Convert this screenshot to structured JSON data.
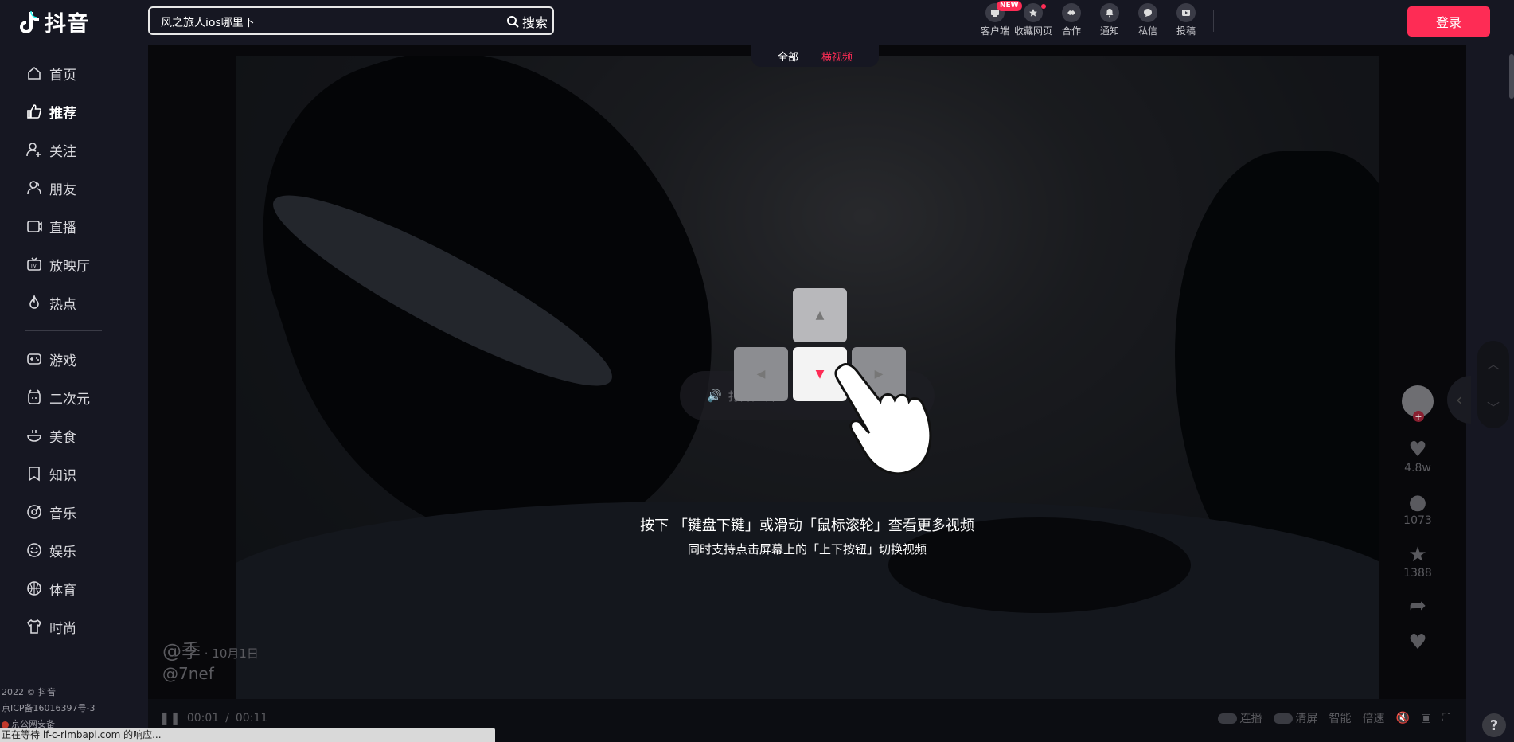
{
  "app": {
    "logo_text": "抖音",
    "accent": "#fe2c55"
  },
  "sidebar": {
    "items": [
      {
        "label": "首页",
        "icon": "home-icon"
      },
      {
        "label": "推荐",
        "icon": "thumbs-up-icon",
        "active": true
      },
      {
        "label": "关注",
        "icon": "user-plus-icon"
      },
      {
        "label": "朋友",
        "icon": "friends-icon"
      },
      {
        "label": "直播",
        "icon": "live-tv-icon"
      },
      {
        "label": "放映厅",
        "icon": "tv-icon"
      },
      {
        "label": "热点",
        "icon": "flame-icon"
      },
      {
        "label": "游戏",
        "icon": "gamepad-icon"
      },
      {
        "label": "二次元",
        "icon": "anime-icon"
      },
      {
        "label": "美食",
        "icon": "bowl-icon"
      },
      {
        "label": "知识",
        "icon": "book-icon"
      },
      {
        "label": "音乐",
        "icon": "music-disc-icon"
      },
      {
        "label": "娱乐",
        "icon": "smile-icon"
      },
      {
        "label": "体育",
        "icon": "ball-icon"
      },
      {
        "label": "时尚",
        "icon": "shirt-icon"
      }
    ],
    "footer": {
      "copyright": "2022 © 抖音",
      "icp": "京ICP备16016397号-3",
      "police": "京公网安备"
    }
  },
  "search": {
    "value": "风之旅人ios哪里下",
    "button_label": "搜索"
  },
  "toolbar": {
    "items": [
      {
        "label": "客户端",
        "icon": "client-icon",
        "badge": "NEW"
      },
      {
        "label": "收藏网页",
        "icon": "star-icon",
        "dot": true
      },
      {
        "label": "合作",
        "icon": "handshake-icon"
      },
      {
        "label": "通知",
        "icon": "bell-icon"
      },
      {
        "label": "私信",
        "icon": "message-icon"
      },
      {
        "label": "投稿",
        "icon": "upload-video-icon"
      }
    ],
    "login_label": "登录"
  },
  "video": {
    "tabs": [
      {
        "label": "全部",
        "active": false
      },
      {
        "label": "横视频",
        "active": true
      }
    ],
    "sound_hint": "打开声音",
    "guide_line1": "按下 「键盘下键」或滑动「鼠标滚轮」查看更多视频",
    "guide_line2": "同时支持点击屏幕上的「上下按钮」切换视频",
    "author_name": "@季",
    "author_date": " · 10月1日",
    "author_handle": "@7nef",
    "likes": "4.8w",
    "comments": "1073",
    "favorites": "1388",
    "time_current": "00:01",
    "time_sep": "/",
    "time_total": "00:11",
    "controls": {
      "autoplay": "连播",
      "clear_screen": "清屏",
      "smart": "智能",
      "speed": "倍速"
    }
  },
  "statusbar": {
    "text": "正在等待 lf-c-rlmbapi.com 的响应..."
  }
}
